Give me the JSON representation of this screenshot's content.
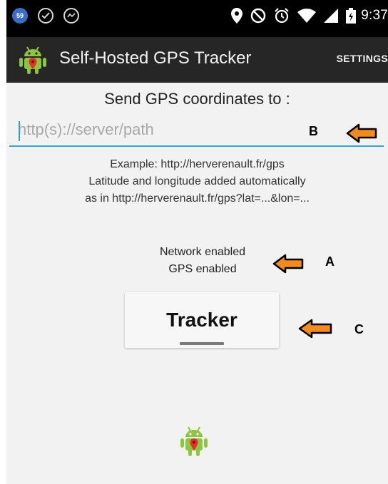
{
  "status_bar": {
    "notification_badge": "59",
    "time": "9:37",
    "icons": [
      "notification-badge-icon",
      "check-shield-icon",
      "messenger-icon",
      "location-pin-icon",
      "no-disturb-icon",
      "alarm-icon",
      "wifi-icon",
      "signal-icon",
      "battery-icon"
    ]
  },
  "action_bar": {
    "title": "Self-Hosted GPS Tracker",
    "settings_label": "SETTINGS"
  },
  "form": {
    "send_label": "Send GPS coordinates to :",
    "url_placeholder": "http(s)://server/path",
    "url_value": "",
    "example_lines": [
      "Example: http://herverenault.fr/gps",
      "Latitude and longitude added automatically",
      "as in http://herverenault.fr/gps?lat=...&lon=..."
    ]
  },
  "status": {
    "network": "Network enabled",
    "gps": "GPS enabled"
  },
  "tracker_button": {
    "label": "Tracker",
    "state": "off"
  },
  "annotations": {
    "a": "A",
    "b": "B",
    "c": "C",
    "arrow_color": "#f28a1e"
  },
  "colors": {
    "accent": "#3aa3c9",
    "action_bar": "#262626",
    "background": "#f2f2f2",
    "android_green": "#8cc63f",
    "marker_red": "#e0312b"
  }
}
